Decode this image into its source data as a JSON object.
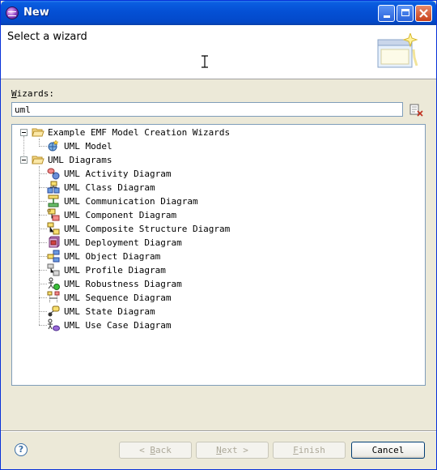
{
  "window": {
    "title": "New",
    "minimize_icon": "minimize-icon",
    "maximize_icon": "maximize-icon",
    "close_icon": "close-icon"
  },
  "banner": {
    "title": "Select a wizard"
  },
  "wizards": {
    "label_accel": "W",
    "label_rest": "izards:",
    "filter_value": "uml"
  },
  "tree": {
    "groups": [
      {
        "label": "Example EMF Model Creation Wizards",
        "expanded": true,
        "items": [
          {
            "label": "UML Model",
            "icon": "uml-model-icon"
          }
        ]
      },
      {
        "label": "UML Diagrams",
        "expanded": true,
        "items": [
          {
            "label": "UML Activity Diagram",
            "icon": "activity-diagram-icon"
          },
          {
            "label": "UML Class Diagram",
            "icon": "class-diagram-icon"
          },
          {
            "label": "UML Communication Diagram",
            "icon": "communication-diagram-icon"
          },
          {
            "label": "UML Component Diagram",
            "icon": "component-diagram-icon"
          },
          {
            "label": "UML Composite Structure Diagram",
            "icon": "composite-structure-diagram-icon"
          },
          {
            "label": "UML Deployment Diagram",
            "icon": "deployment-diagram-icon"
          },
          {
            "label": "UML Object Diagram",
            "icon": "object-diagram-icon"
          },
          {
            "label": "UML Profile Diagram",
            "icon": "profile-diagram-icon"
          },
          {
            "label": "UML Robustness Diagram",
            "icon": "robustness-diagram-icon"
          },
          {
            "label": "UML Sequence Diagram",
            "icon": "sequence-diagram-icon"
          },
          {
            "label": "UML State Diagram",
            "icon": "state-diagram-icon"
          },
          {
            "label": "UML Use Case Diagram",
            "icon": "use-case-diagram-icon"
          }
        ]
      }
    ]
  },
  "buttons": {
    "back": {
      "arrow": "<",
      "accel": "B",
      "rest": "ack",
      "enabled": false
    },
    "next": {
      "accel": "N",
      "rest": "ext",
      "arrow": ">",
      "enabled": false
    },
    "finish": {
      "accel": "F",
      "rest": "inish",
      "enabled": false
    },
    "cancel": {
      "label": "Cancel",
      "enabled": true
    }
  },
  "colors": {
    "titlebar": "#0551d6",
    "dialog_bg": "#ece9d8",
    "field_border": "#7f9db9"
  }
}
